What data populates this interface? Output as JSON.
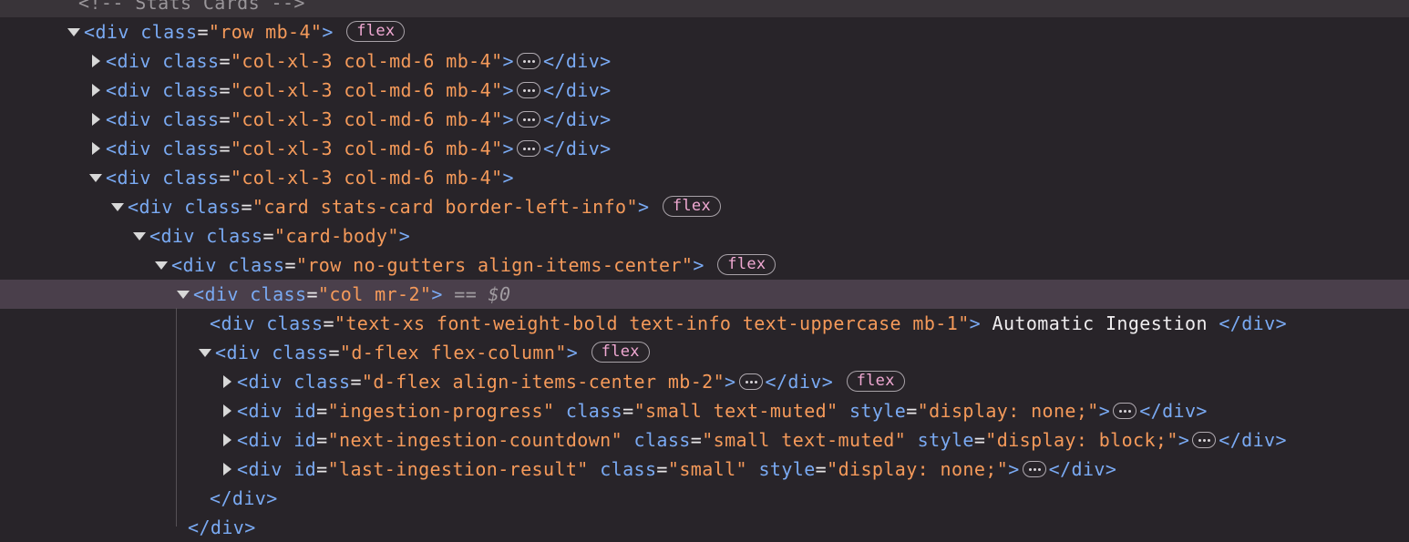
{
  "lines": [
    {
      "comment": "<!-- Stats Cards -->"
    },
    {
      "tag": "div",
      "attrs": [
        {
          "name": "class",
          "value": "row mb-4"
        }
      ],
      "badge": "flex"
    },
    {
      "tag": "div",
      "attrs": [
        {
          "name": "class",
          "value": "col-xl-3 col-md-6 mb-4"
        }
      ],
      "close": "</div>"
    },
    {
      "tag": "div",
      "attrs": [
        {
          "name": "class",
          "value": "col-xl-3 col-md-6 mb-4"
        }
      ],
      "close": "</div>"
    },
    {
      "tag": "div",
      "attrs": [
        {
          "name": "class",
          "value": "col-xl-3 col-md-6 mb-4"
        }
      ],
      "close": "</div>"
    },
    {
      "tag": "div",
      "attrs": [
        {
          "name": "class",
          "value": "col-xl-3 col-md-6 mb-4"
        }
      ],
      "close": "</div>"
    },
    {
      "tag": "div",
      "attrs": [
        {
          "name": "class",
          "value": "col-xl-3 col-md-6 mb-4"
        }
      ]
    },
    {
      "tag": "div",
      "attrs": [
        {
          "name": "class",
          "value": "card stats-card border-left-info"
        }
      ],
      "badge": "flex"
    },
    {
      "tag": "div",
      "attrs": [
        {
          "name": "class",
          "value": "card-body"
        }
      ]
    },
    {
      "tag": "div",
      "attrs": [
        {
          "name": "class",
          "value": "row no-gutters align-items-center"
        }
      ],
      "badge": "flex"
    },
    {
      "tag": "div",
      "attrs": [
        {
          "name": "class",
          "value": "col mr-2"
        }
      ],
      "selected_marker": "== ",
      "selected_ref": "$0"
    },
    {
      "tag": "div",
      "attrs": [
        {
          "name": "class",
          "value": "text-xs font-weight-bold text-info text-uppercase mb-1"
        }
      ],
      "text": " Automatic Ingestion ",
      "close": "</div>"
    },
    {
      "tag": "div",
      "attrs": [
        {
          "name": "class",
          "value": "d-flex flex-column"
        }
      ],
      "badge": "flex"
    },
    {
      "tag": "div",
      "attrs": [
        {
          "name": "class",
          "value": "d-flex align-items-center mb-2"
        }
      ],
      "close": "</div>",
      "badge": "flex"
    },
    {
      "tag": "div",
      "attrs": [
        {
          "name": "id",
          "value": "ingestion-progress"
        },
        {
          "name": "class",
          "value": "small text-muted"
        },
        {
          "name": "style",
          "value": "display: none;"
        }
      ],
      "close": "</div>"
    },
    {
      "tag": "div",
      "attrs": [
        {
          "name": "id",
          "value": "next-ingestion-countdown"
        },
        {
          "name": "class",
          "value": "small text-muted"
        },
        {
          "name": "style",
          "value": "display: block;"
        }
      ],
      "close": "</div>"
    },
    {
      "tag": "div",
      "attrs": [
        {
          "name": "id",
          "value": "last-ingestion-result"
        },
        {
          "name": "class",
          "value": "small"
        },
        {
          "name": "style",
          "value": "display: none;"
        }
      ],
      "close": "</div>"
    },
    {
      "closing_only": "</div>"
    },
    {
      "closing_only": "</div>"
    }
  ]
}
